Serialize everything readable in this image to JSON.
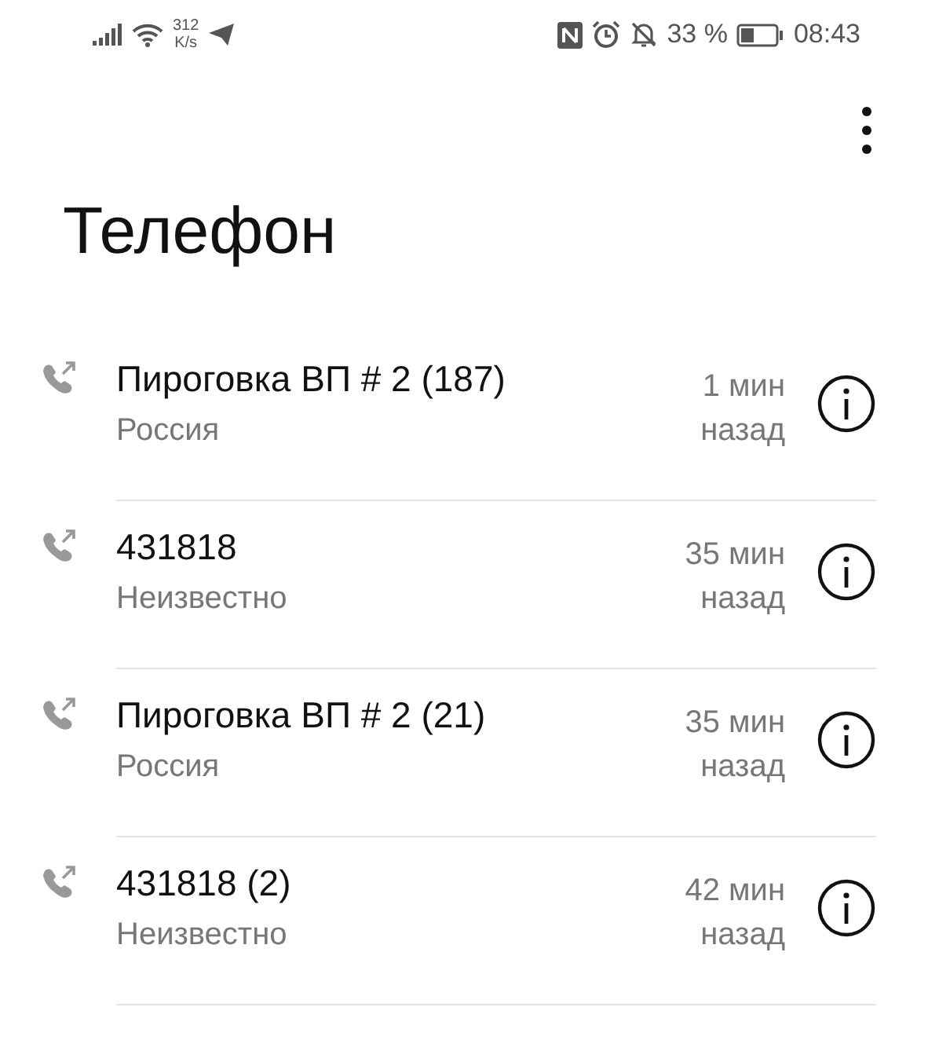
{
  "status_bar": {
    "speed_value": "312",
    "speed_unit": "K/s",
    "battery_percent": "33 %",
    "time": "08:43"
  },
  "title": "Телефон",
  "calls": [
    {
      "name": "Пироговка ВП # 2 (187)",
      "location": "Россия",
      "time": "1 мин назад"
    },
    {
      "name": "431818",
      "location": "Неизвестно",
      "time": "35 мин назад"
    },
    {
      "name": "Пироговка ВП # 2 (21)",
      "location": "Россия",
      "time": "35 мин назад"
    },
    {
      "name": "431818 (2)",
      "location": "Неизвестно",
      "time": "42 мин назад"
    }
  ]
}
